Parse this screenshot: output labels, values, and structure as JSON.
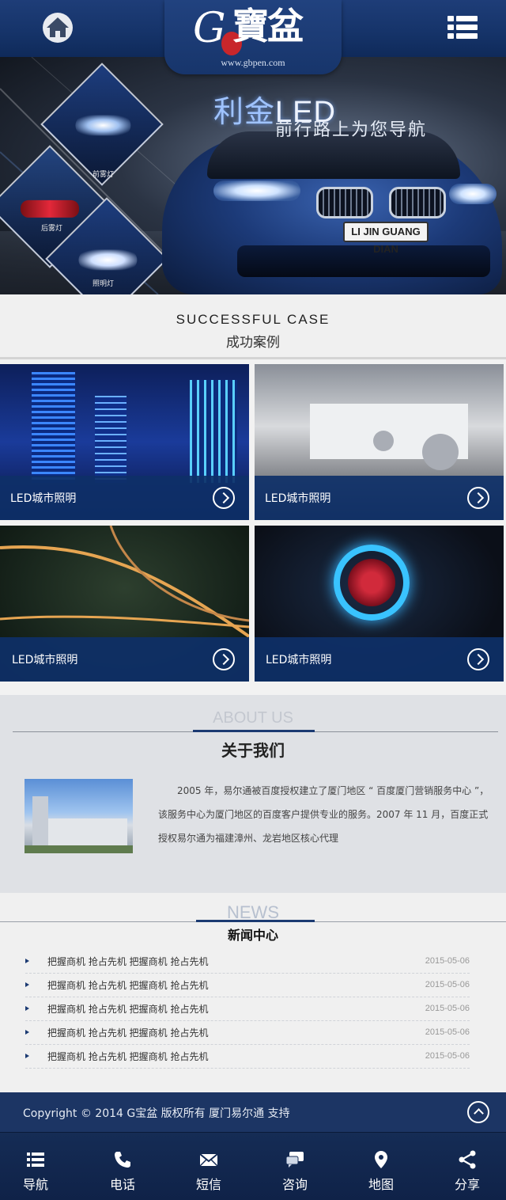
{
  "header": {
    "home_icon": "home-icon",
    "menu_icon": "menu-grid-icon",
    "logo_letter": "G",
    "logo_cn": "寶盆",
    "logo_url": "www.gbpen.com"
  },
  "banner": {
    "title_accent": "利金",
    "title_rest": "LED",
    "subtitle": "前行路上为您导航",
    "plate": "LI JIN GUANG DIAN",
    "labels": [
      "前雾灯",
      "后雾灯",
      "照明灯"
    ]
  },
  "cases": {
    "title_en": "SUCCESSFUL CASE",
    "title_cn": "成功案例",
    "items": [
      {
        "label": "LED城市照明"
      },
      {
        "label": "LED城市照明"
      },
      {
        "label": "LED城市照明"
      },
      {
        "label": "LED城市照明"
      }
    ]
  },
  "about": {
    "title_en": "ABOUT US",
    "title_cn": "关于我们",
    "text": "2005 年，易尔通被百度授权建立了厦门地区 “ 百度厦门营销服务中心 ”，该服务中心为厦门地区的百度客户提供专业的服务。2007 年 11 月，百度正式授权易尔通为福建漳州、龙岩地区核心代理"
  },
  "news": {
    "title_en": "NEWS",
    "title_cn": "新闻中心",
    "items": [
      {
        "title": "把握商机 抢占先机 把握商机 抢占先机",
        "date": "2015-05-06"
      },
      {
        "title": "把握商机 抢占先机 把握商机 抢占先机",
        "date": "2015-05-06"
      },
      {
        "title": "把握商机 抢占先机 把握商机 抢占先机",
        "date": "2015-05-06"
      },
      {
        "title": "把握商机 抢占先机 把握商机 抢占先机",
        "date": "2015-05-06"
      },
      {
        "title": "把握商机 抢占先机 把握商机 抢占先机",
        "date": "2015-05-06"
      }
    ]
  },
  "footer": {
    "copyright": "Copyright © 2014 G宝盆 版权所有 厦门易尔通 支持",
    "top_icon": "chevron-up-icon"
  },
  "tabbar": {
    "items": [
      {
        "label": "导航",
        "icon": "list-icon"
      },
      {
        "label": "电话",
        "icon": "phone-icon"
      },
      {
        "label": "短信",
        "icon": "envelope-icon"
      },
      {
        "label": "咨询",
        "icon": "chat-icon"
      },
      {
        "label": "地图",
        "icon": "map-pin-icon"
      },
      {
        "label": "分享",
        "icon": "share-icon"
      }
    ]
  },
  "colors": {
    "primary": "#1c3564",
    "accent": "#1b3a72",
    "case_bar": "#0e3068"
  }
}
